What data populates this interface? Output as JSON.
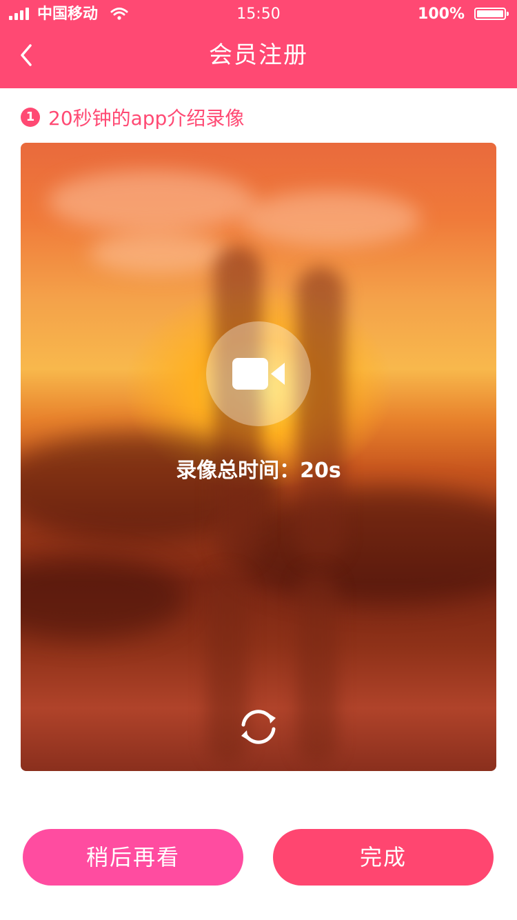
{
  "status_bar": {
    "carrier": "中国移动",
    "time": "15:50",
    "battery": "100%",
    "battery_level": 1.0
  },
  "nav": {
    "title": "会员注册",
    "back_icon": "chevron-left-icon"
  },
  "section": {
    "step_number": "1",
    "label": "20秒钟的app介绍录像"
  },
  "video": {
    "record_icon": "video-camera-icon",
    "duration_text": "录像总时间：20s",
    "refresh_icon": "refresh-icon"
  },
  "actions": {
    "later_label": "稍后再看",
    "done_label": "完成"
  },
  "colors": {
    "primary": "#ff4973",
    "later_button": "#ff4ca0",
    "done_button": "#ff4670"
  }
}
